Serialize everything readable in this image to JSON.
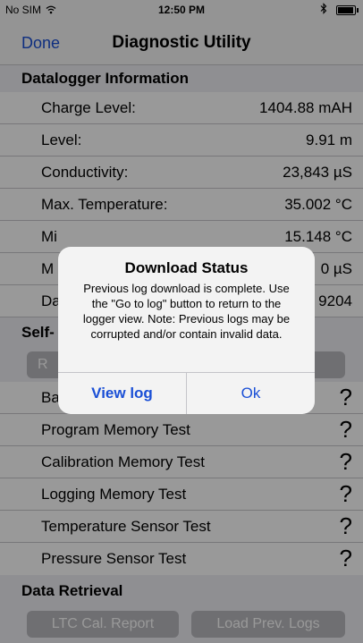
{
  "status_bar": {
    "carrier": "No SIM",
    "wifi_icon": "wifi-icon",
    "time": "12:50 PM",
    "bluetooth_icon": "bluetooth-icon",
    "battery_icon": "battery-icon"
  },
  "nav": {
    "done": "Done",
    "title": "Diagnostic Utility"
  },
  "sections": {
    "datalogger": {
      "header": "Datalogger Information",
      "rows": [
        {
          "label": "Charge Level:",
          "value": "1404.88 mAH"
        },
        {
          "label": "Level:",
          "value": "9.91 m"
        },
        {
          "label": "Conductivity:",
          "value": "23,843 µS"
        },
        {
          "label": "Max. Temperature:",
          "value": "35.002 °C"
        },
        {
          "label": "Mi",
          "value": "15.148 °C"
        },
        {
          "label": "M",
          "value": "0 µS"
        },
        {
          "label": "Da",
          "value": "9204"
        }
      ]
    },
    "self_test": {
      "header": "Self-",
      "run_button": "R",
      "rows": [
        {
          "label": "Ba",
          "status": "?"
        },
        {
          "label": "Program Memory Test",
          "status": "?"
        },
        {
          "label": "Calibration Memory Test",
          "status": "?"
        },
        {
          "label": "Logging Memory Test",
          "status": "?"
        },
        {
          "label": "Temperature Sensor Test",
          "status": "?"
        },
        {
          "label": "Pressure Sensor Test",
          "status": "?"
        }
      ]
    },
    "data_retrieval": {
      "header": "Data Retrieval",
      "ltc_button": "LTC Cal. Report",
      "load_button": "Load Prev. Logs"
    }
  },
  "alert": {
    "title": "Download Status",
    "message": "Previous log download is complete. Use the \"Go to log\" button to return to the logger view. Note: Previous logs may be corrupted and/or contain invalid data.",
    "view_log": "View log",
    "ok": "Ok"
  },
  "colors": {
    "accent": "#1a4fd6",
    "section_bg": "#efeff4",
    "disabled_button": "#b9b9be"
  }
}
